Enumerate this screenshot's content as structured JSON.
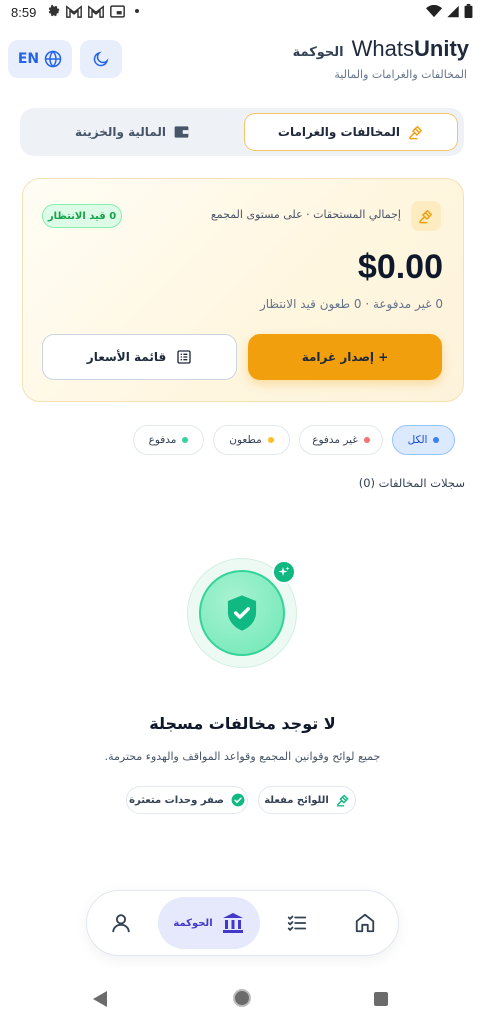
{
  "status_bar": {
    "time": "8:59"
  },
  "header": {
    "lang_label": "EN",
    "brand_gov": "الحوكمة",
    "brand_name_a": "Whats",
    "brand_name_b": "Unity",
    "subtitle": "المخالفات والغرامات والمالية"
  },
  "tabs": [
    {
      "label": "المخالفات والغرامات",
      "active": true
    },
    {
      "label": "المالية والخزينة",
      "active": false
    }
  ],
  "summary": {
    "label": "إجمالي المستحقات · على مستوى المجمع",
    "pending_badge": "0 قيد الانتظار",
    "amount": "$0.00",
    "subtext": "0 غير مدفوعة · 0 طعون قيد الانتظار",
    "issue_fine_button": "+ إصدار غرامة",
    "price_list_button": "قائمة الأسعار"
  },
  "filters": [
    {
      "label": "الكل",
      "dot_color": "#3b82f6",
      "active": true
    },
    {
      "label": "غير مدفوع",
      "dot_color": "#f87171",
      "active": false
    },
    {
      "label": "مطعون",
      "dot_color": "#fbbf24",
      "active": false
    },
    {
      "label": "مدفوع",
      "dot_color": "#34d399",
      "active": false
    }
  ],
  "records_title": "سجلات المخالفات (0)",
  "empty_state": {
    "title": "لا توجد مخالفات مسجلة",
    "description": "جميع لوائح وقوانين المجمع وقواعد المواقف والهدوء محترمة.",
    "pills": [
      {
        "label": "اللوائح مفعلة",
        "icon": "gavel-icon"
      },
      {
        "label": "صفر وحدات متعثرة",
        "icon": "check-circle-icon"
      }
    ]
  },
  "bottom_nav": {
    "items": [
      {
        "icon": "home-icon",
        "label": ""
      },
      {
        "icon": "list-icon",
        "label": ""
      },
      {
        "icon": "bank-icon",
        "label": "الحوكمة",
        "active": true
      },
      {
        "icon": "user-icon",
        "label": ""
      }
    ]
  },
  "colors": {
    "accent_orange": "#f29f0e",
    "primary_blue": "#2563eb",
    "success_green": "#10b981"
  }
}
